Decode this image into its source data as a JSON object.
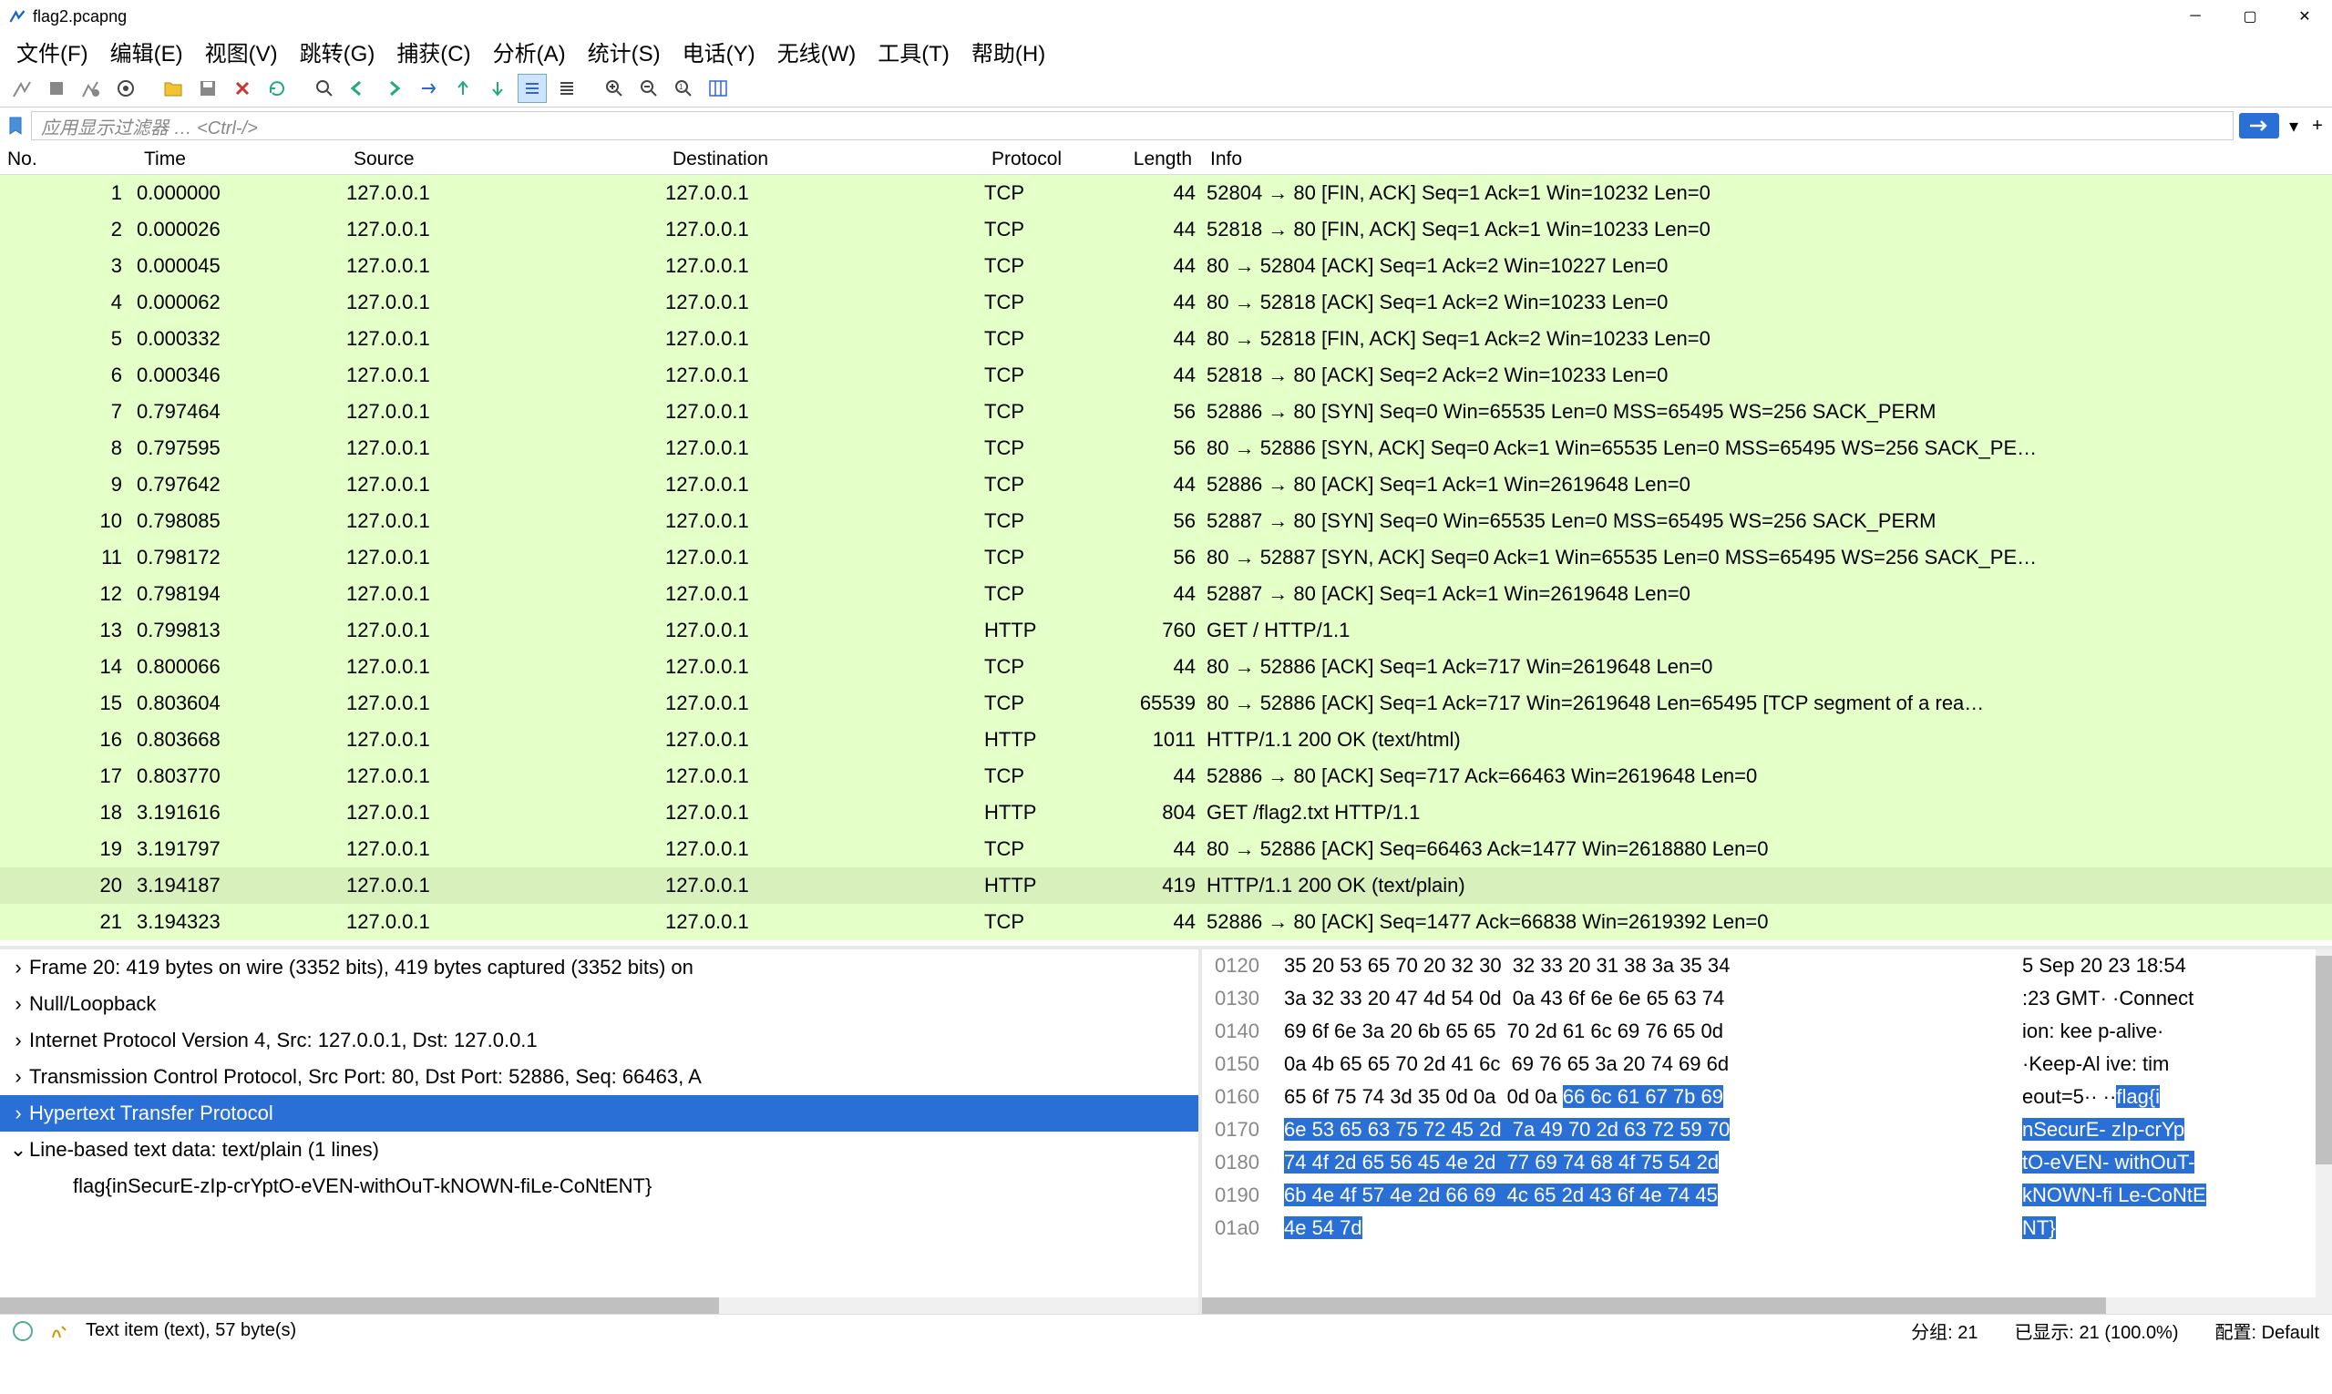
{
  "window": {
    "title": "flag2.pcapng"
  },
  "menus": [
    "文件(F)",
    "编辑(E)",
    "视图(V)",
    "跳转(G)",
    "捕获(C)",
    "分析(A)",
    "统计(S)",
    "电话(Y)",
    "无线(W)",
    "工具(T)",
    "帮助(H)"
  ],
  "filter": {
    "placeholder": "应用显示过滤器 … <Ctrl-/>"
  },
  "packet_columns": [
    "No.",
    "Time",
    "Source",
    "Destination",
    "Protocol",
    "Length",
    "Info"
  ],
  "packets": [
    {
      "no": 1,
      "time": "0.000000",
      "src": "127.0.0.1",
      "dst": "127.0.0.1",
      "proto": "TCP",
      "len": 44,
      "info": "52804 → 80 [FIN, ACK] Seq=1 Ack=1 Win=10232 Len=0"
    },
    {
      "no": 2,
      "time": "0.000026",
      "src": "127.0.0.1",
      "dst": "127.0.0.1",
      "proto": "TCP",
      "len": 44,
      "info": "52818 → 80 [FIN, ACK] Seq=1 Ack=1 Win=10233 Len=0"
    },
    {
      "no": 3,
      "time": "0.000045",
      "src": "127.0.0.1",
      "dst": "127.0.0.1",
      "proto": "TCP",
      "len": 44,
      "info": "80 → 52804 [ACK] Seq=1 Ack=2 Win=10227 Len=0"
    },
    {
      "no": 4,
      "time": "0.000062",
      "src": "127.0.0.1",
      "dst": "127.0.0.1",
      "proto": "TCP",
      "len": 44,
      "info": "80 → 52818 [ACK] Seq=1 Ack=2 Win=10233 Len=0"
    },
    {
      "no": 5,
      "time": "0.000332",
      "src": "127.0.0.1",
      "dst": "127.0.0.1",
      "proto": "TCP",
      "len": 44,
      "info": "80 → 52818 [FIN, ACK] Seq=1 Ack=2 Win=10233 Len=0"
    },
    {
      "no": 6,
      "time": "0.000346",
      "src": "127.0.0.1",
      "dst": "127.0.0.1",
      "proto": "TCP",
      "len": 44,
      "info": "52818 → 80 [ACK] Seq=2 Ack=2 Win=10233 Len=0"
    },
    {
      "no": 7,
      "time": "0.797464",
      "src": "127.0.0.1",
      "dst": "127.0.0.1",
      "proto": "TCP",
      "len": 56,
      "info": "52886 → 80 [SYN] Seq=0 Win=65535 Len=0 MSS=65495 WS=256 SACK_PERM"
    },
    {
      "no": 8,
      "time": "0.797595",
      "src": "127.0.0.1",
      "dst": "127.0.0.1",
      "proto": "TCP",
      "len": 56,
      "info": "80 → 52886 [SYN, ACK] Seq=0 Ack=1 Win=65535 Len=0 MSS=65495 WS=256 SACK_PE…"
    },
    {
      "no": 9,
      "time": "0.797642",
      "src": "127.0.0.1",
      "dst": "127.0.0.1",
      "proto": "TCP",
      "len": 44,
      "info": "52886 → 80 [ACK] Seq=1 Ack=1 Win=2619648 Len=0"
    },
    {
      "no": 10,
      "time": "0.798085",
      "src": "127.0.0.1",
      "dst": "127.0.0.1",
      "proto": "TCP",
      "len": 56,
      "info": "52887 → 80 [SYN] Seq=0 Win=65535 Len=0 MSS=65495 WS=256 SACK_PERM"
    },
    {
      "no": 11,
      "time": "0.798172",
      "src": "127.0.0.1",
      "dst": "127.0.0.1",
      "proto": "TCP",
      "len": 56,
      "info": "80 → 52887 [SYN, ACK] Seq=0 Ack=1 Win=65535 Len=0 MSS=65495 WS=256 SACK_PE…"
    },
    {
      "no": 12,
      "time": "0.798194",
      "src": "127.0.0.1",
      "dst": "127.0.0.1",
      "proto": "TCP",
      "len": 44,
      "info": "52887 → 80 [ACK] Seq=1 Ack=1 Win=2619648 Len=0"
    },
    {
      "no": 13,
      "time": "0.799813",
      "src": "127.0.0.1",
      "dst": "127.0.0.1",
      "proto": "HTTP",
      "len": 760,
      "info": "GET / HTTP/1.1"
    },
    {
      "no": 14,
      "time": "0.800066",
      "src": "127.0.0.1",
      "dst": "127.0.0.1",
      "proto": "TCP",
      "len": 44,
      "info": "80 → 52886 [ACK] Seq=1 Ack=717 Win=2619648 Len=0"
    },
    {
      "no": 15,
      "time": "0.803604",
      "src": "127.0.0.1",
      "dst": "127.0.0.1",
      "proto": "TCP",
      "len": 65539,
      "info": "80 → 52886 [ACK] Seq=1 Ack=717 Win=2619648 Len=65495 [TCP segment of a rea…"
    },
    {
      "no": 16,
      "time": "0.803668",
      "src": "127.0.0.1",
      "dst": "127.0.0.1",
      "proto": "HTTP",
      "len": 1011,
      "info": "HTTP/1.1 200 OK  (text/html)"
    },
    {
      "no": 17,
      "time": "0.803770",
      "src": "127.0.0.1",
      "dst": "127.0.0.1",
      "proto": "TCP",
      "len": 44,
      "info": "52886 → 80 [ACK] Seq=717 Ack=66463 Win=2619648 Len=0"
    },
    {
      "no": 18,
      "time": "3.191616",
      "src": "127.0.0.1",
      "dst": "127.0.0.1",
      "proto": "HTTP",
      "len": 804,
      "info": "GET /flag2.txt HTTP/1.1"
    },
    {
      "no": 19,
      "time": "3.191797",
      "src": "127.0.0.1",
      "dst": "127.0.0.1",
      "proto": "TCP",
      "len": 44,
      "info": "80 → 52886 [ACK] Seq=66463 Ack=1477 Win=2618880 Len=0"
    },
    {
      "no": 20,
      "time": "3.194187",
      "src": "127.0.0.1",
      "dst": "127.0.0.1",
      "proto": "HTTP",
      "len": 419,
      "info": "HTTP/1.1 200 OK  (text/plain)",
      "selected": true
    },
    {
      "no": 21,
      "time": "3.194323",
      "src": "127.0.0.1",
      "dst": "127.0.0.1",
      "proto": "TCP",
      "len": 44,
      "info": "52886 → 80 [ACK] Seq=1477 Ack=66838 Win=2619392 Len=0"
    }
  ],
  "tree": {
    "frame": "Frame 20: 419 bytes on wire (3352 bits), 419 bytes captured (3352 bits) on",
    "null": "Null/Loopback",
    "ip": "Internet Protocol Version 4, Src: 127.0.0.1, Dst: 127.0.0.1",
    "tcp": "Transmission Control Protocol, Src Port: 80, Dst Port: 52886, Seq: 66463, A",
    "http": "Hypertext Transfer Protocol",
    "line": "Line-based text data: text/plain (1 lines)",
    "flag": "flag{inSecurE-zIp-crYptO-eVEN-withOuT-kNOWN-fiLe-CoNtENT}"
  },
  "hex": [
    {
      "off": "0120",
      "b": "35 20 53 65 70 20 32 30  32 33 20 31 38 3a 35 34",
      "a": "5 Sep 20 23 18:54"
    },
    {
      "off": "0130",
      "b": "3a 32 33 20 47 4d 54 0d  0a 43 6f 6e 6e 65 63 74",
      "a": ":23 GMT· ·Connect"
    },
    {
      "off": "0140",
      "b": "69 6f 6e 3a 20 6b 65 65  70 2d 61 6c 69 76 65 0d",
      "a": "ion: kee p-alive·"
    },
    {
      "off": "0150",
      "b": "0a 4b 65 65 70 2d 41 6c  69 76 65 3a 20 74 69 6d",
      "a": "·Keep-Al ive: tim"
    },
    {
      "off": "0160",
      "b1": "65 6f 75 74 3d 35 0d 0a  0d 0a ",
      "b2": "66 6c 61 67 7b 69",
      "a1": "eout=5·· ··",
      "a2": "flag{i"
    },
    {
      "off": "0170",
      "bhl": "6e 53 65 63 75 72 45 2d  7a 49 70 2d 63 72 59 70",
      "ahl": "nSecurE- zIp-crYp"
    },
    {
      "off": "0180",
      "bhl": "74 4f 2d 65 56 45 4e 2d  77 69 74 68 4f 75 54 2d",
      "ahl": "tO-eVEN- withOuT-"
    },
    {
      "off": "0190",
      "bhl": "6b 4e 4f 57 4e 2d 66 69  4c 65 2d 43 6f 4e 74 45",
      "ahl": "kNOWN-fi Le-CoNtE"
    },
    {
      "off": "01a0",
      "bhl": "4e 54 7d",
      "ahl": "NT}"
    }
  ],
  "status": {
    "left": "Text item (text), 57 byte(s)",
    "packets": "分组: 21",
    "displayed": "已显示: 21 (100.0%)",
    "profile": "配置: Default"
  }
}
